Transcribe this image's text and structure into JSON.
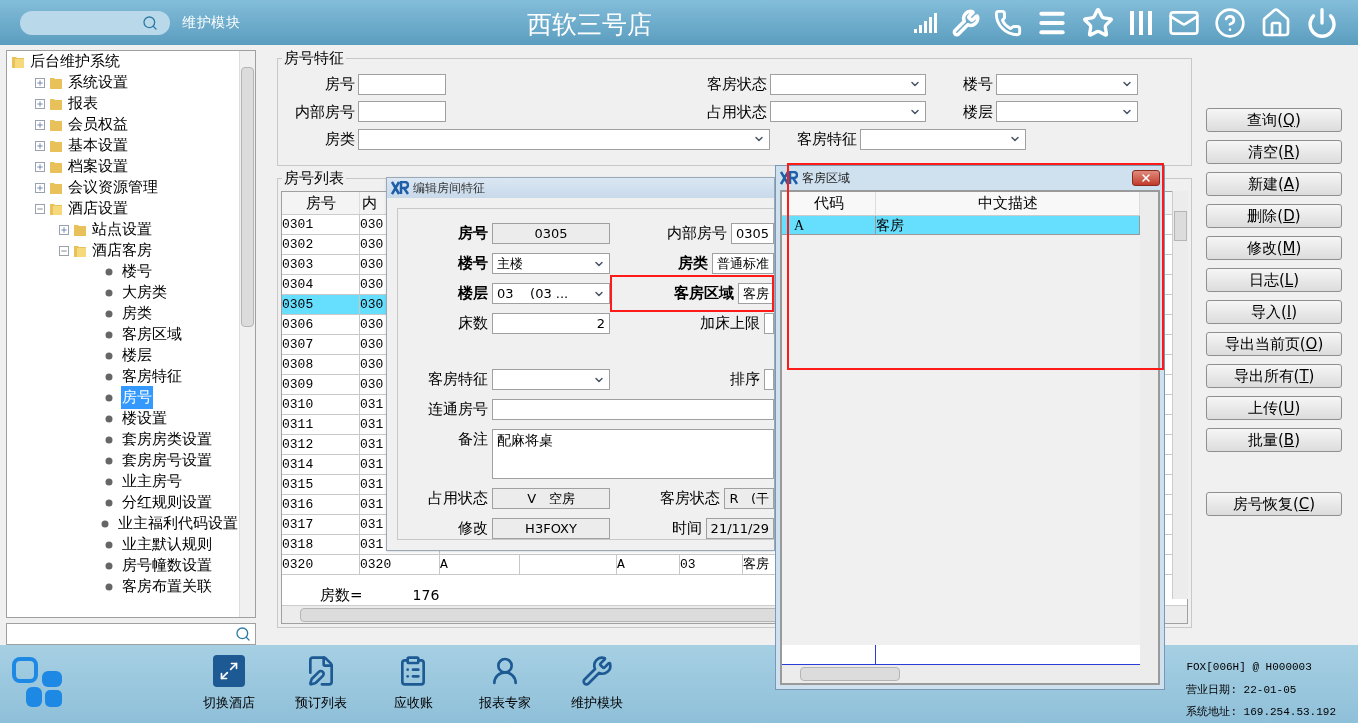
{
  "top_bar": {
    "module": "维护模块",
    "title": "西软三号店"
  },
  "tree": {
    "items": [
      {
        "label": "后台维护系统",
        "kind": "folder",
        "expanded": true,
        "selected": false,
        "children": [
          {
            "label": "系统设置",
            "kind": "folder",
            "expanded": false,
            "selected": false
          },
          {
            "label": "报表",
            "kind": "folder",
            "expanded": false,
            "selected": false
          },
          {
            "label": "会员权益",
            "kind": "folder",
            "expanded": false,
            "selected": false
          },
          {
            "label": "基本设置",
            "kind": "folder",
            "expanded": false,
            "selected": false
          },
          {
            "label": "档案设置",
            "kind": "folder",
            "expanded": false,
            "selected": false
          },
          {
            "label": "会议资源管理",
            "kind": "folder",
            "expanded": false,
            "selected": false
          },
          {
            "label": "酒店设置",
            "kind": "folder",
            "expanded": true,
            "selected": false,
            "children": [
              {
                "label": "站点设置",
                "kind": "folder",
                "expanded": false,
                "selected": false
              },
              {
                "label": "酒店客房",
                "kind": "folder",
                "expanded": true,
                "selected": false,
                "children": [
                  {
                    "label": "楼号",
                    "kind": "leaf",
                    "selected": false
                  },
                  {
                    "label": "大房类",
                    "kind": "leaf",
                    "selected": false
                  },
                  {
                    "label": "房类",
                    "kind": "leaf",
                    "selected": false
                  },
                  {
                    "label": "客房区域",
                    "kind": "leaf",
                    "selected": false
                  },
                  {
                    "label": "楼层",
                    "kind": "leaf",
                    "selected": false
                  },
                  {
                    "label": "客房特征",
                    "kind": "leaf",
                    "selected": false
                  },
                  {
                    "label": "房号",
                    "kind": "leaf",
                    "selected": true
                  },
                  {
                    "label": "楼设置",
                    "kind": "leaf",
                    "selected": false
                  },
                  {
                    "label": "套房房类设置",
                    "kind": "leaf",
                    "selected": false
                  },
                  {
                    "label": "套房房号设置",
                    "kind": "leaf",
                    "selected": false
                  },
                  {
                    "label": "业主房号",
                    "kind": "leaf",
                    "selected": false
                  },
                  {
                    "label": "分红规则设置",
                    "kind": "leaf",
                    "selected": false
                  },
                  {
                    "label": "业主福利代码设置",
                    "kind": "leaf",
                    "selected": false
                  },
                  {
                    "label": "业主默认规则",
                    "kind": "leaf",
                    "selected": false
                  },
                  {
                    "label": "房号幢数设置",
                    "kind": "leaf",
                    "selected": false
                  },
                  {
                    "label": "客房布置关联",
                    "kind": "leaf",
                    "selected": false
                  }
                ]
              }
            ]
          }
        ]
      }
    ]
  },
  "filter": {
    "legend": "房号特征",
    "rows": [
      [
        {
          "label": "房号",
          "kind": "text"
        },
        {
          "label": "客房状态",
          "kind": "select"
        },
        {
          "label": "楼号",
          "kind": "select"
        }
      ],
      [
        {
          "label": "内部房号",
          "kind": "text"
        },
        {
          "label": "占用状态",
          "kind": "select"
        },
        {
          "label": "楼层",
          "kind": "select"
        }
      ],
      [
        {
          "label": "房类",
          "kind": "wide_select"
        },
        {
          "label": "客房特征",
          "kind": "select"
        }
      ]
    ]
  },
  "buttons": [
    {
      "label": "查询(Q)",
      "kind": "action"
    },
    {
      "label": "清空(R)",
      "kind": "action"
    },
    {
      "label": "新建(A)",
      "kind": "action"
    },
    {
      "label": "删除(D)",
      "kind": "action"
    },
    {
      "label": "修改(M)",
      "kind": "action"
    },
    {
      "label": "日志(L)",
      "kind": "action"
    },
    {
      "label": "导入(I)",
      "kind": "action"
    },
    {
      "label": "导出当前页(O)",
      "kind": "action"
    },
    {
      "label": "导出所有(T)",
      "kind": "action"
    },
    {
      "label": "上传(U)",
      "kind": "action"
    },
    {
      "label": "批量(B)",
      "kind": "action"
    },
    {
      "label": "房号恢复(C)",
      "kind": "separated"
    }
  ],
  "room_list": {
    "legend": "房号列表",
    "columns": [
      "房号",
      "内"
    ],
    "rows": [
      {
        "cells": [
          "0301",
          "030"
        ],
        "selected": false
      },
      {
        "cells": [
          "0302",
          "030"
        ],
        "selected": false
      },
      {
        "cells": [
          "0303",
          "030"
        ],
        "selected": false
      },
      {
        "cells": [
          "0304",
          "030"
        ],
        "selected": false
      },
      {
        "cells": [
          "0305",
          "030"
        ],
        "selected": true
      },
      {
        "cells": [
          "0306",
          "030"
        ],
        "selected": false
      },
      {
        "cells": [
          "0307",
          "030"
        ],
        "selected": false
      },
      {
        "cells": [
          "0308",
          "030"
        ],
        "selected": false
      },
      {
        "cells": [
          "0309",
          "030"
        ],
        "selected": false
      },
      {
        "cells": [
          "0310",
          "031"
        ],
        "selected": false
      },
      {
        "cells": [
          "0311",
          "031"
        ],
        "selected": false
      },
      {
        "cells": [
          "0312",
          "031"
        ],
        "selected": false
      },
      {
        "cells": [
          "0314",
          "031"
        ],
        "selected": false
      },
      {
        "cells": [
          "0315",
          "031"
        ],
        "selected": false
      },
      {
        "cells": [
          "0316",
          "031"
        ],
        "selected": false
      },
      {
        "cells": [
          "0317",
          "031"
        ],
        "selected": false
      },
      {
        "cells": [
          "0318",
          "031"
        ],
        "selected": false
      },
      {
        "cells": [
          "0320",
          "0320",
          "A",
          null,
          "A",
          "03",
          "客房"
        ],
        "selected": false
      }
    ],
    "count_label": "房数=",
    "count": "176"
  },
  "edit_dialog": {
    "title": "编辑房间特征",
    "rows": [
      [
        {
          "label": "房号",
          "value": "0305",
          "kind": "readonly",
          "bold": true
        },
        {
          "label": "内部房号",
          "value": "0305",
          "kind": "text",
          "bold": false
        }
      ],
      [
        {
          "label": "楼号",
          "value": "主楼",
          "kind": "select",
          "bold": true
        },
        {
          "label": "房类",
          "value": "普通标准",
          "kind": "text",
          "bold": true
        }
      ],
      [
        {
          "label": "楼层",
          "value": "03    (03 ...",
          "kind": "select",
          "bold": true
        },
        {
          "label": "客房区域",
          "value": "客房",
          "kind": "text",
          "bold": true
        }
      ],
      [
        {
          "label": "床数",
          "value": "2",
          "kind": "number",
          "bold": false
        },
        {
          "label": "加床上限",
          "kind": "text",
          "bold": false
        }
      ],
      [
        {
          "label": "客房特征",
          "kind": "select",
          "bold": false
        },
        {
          "label": "排序",
          "kind": "text",
          "bold": false
        }
      ],
      [
        {
          "label": "连通房号",
          "kind": "wide",
          "bold": false
        }
      ],
      [
        {
          "label": "备注",
          "value": "配麻将桌",
          "kind": "textarea",
          "bold": false
        }
      ],
      [
        {
          "label": "占用状态",
          "value": "V   空房",
          "kind": "readonly",
          "bold": false
        },
        {
          "label": "客房状态",
          "value": "R   (干",
          "kind": "readonly",
          "bold": false
        }
      ],
      [
        {
          "label": "修改",
          "value": "H3FOXY",
          "kind": "readonly",
          "bold": false
        },
        {
          "label": "时间",
          "value": "21/11/29",
          "kind": "readonly",
          "bold": false
        }
      ]
    ]
  },
  "area_dialog": {
    "title": "客房区域",
    "columns": [
      "代码",
      "中文描述"
    ],
    "rows": [
      {
        "cells": [
          "A",
          "客房"
        ],
        "selected": true
      }
    ]
  },
  "bottom_bar": {
    "apps": [
      {
        "label": "切换酒店",
        "kind": "switch"
      },
      {
        "label": "预订列表",
        "kind": "list"
      },
      {
        "label": "应收账",
        "kind": "clipboard"
      },
      {
        "label": "报表专家",
        "kind": "person"
      },
      {
        "label": "维护模块",
        "kind": "tools"
      }
    ],
    "status": [
      "FOX[006H] @ H000003",
      "营业日期: 22-01-05",
      "系统地址: 169.254.53.192"
    ]
  }
}
